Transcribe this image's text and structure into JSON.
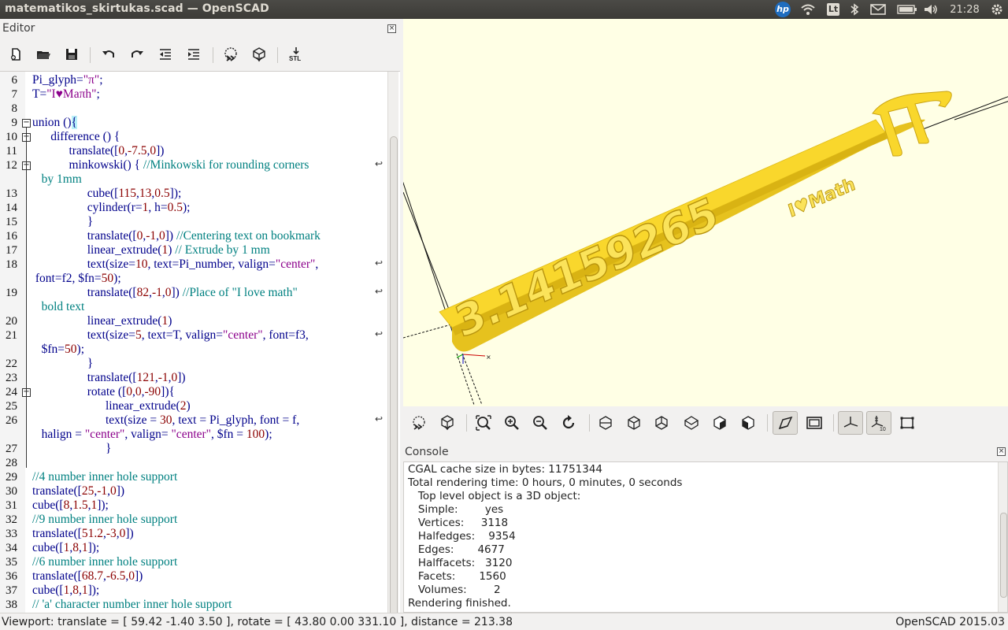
{
  "window": {
    "title": "matematikos_skirtukas.scad — OpenSCAD"
  },
  "tray": {
    "hp_label": "hp",
    "keyboard_layout": "Lt",
    "clock": "21:28",
    "icons": [
      "hp-icon",
      "wifi-icon",
      "keyboard-layout-indicator",
      "bluetooth-icon",
      "mail-icon",
      "battery-icon",
      "volume-icon",
      "settings-gear-icon"
    ]
  },
  "editor": {
    "title": "Editor",
    "toolbar_icons": [
      "new-file-icon",
      "open-file-icon",
      "save-icon",
      "undo-icon",
      "redo-icon",
      "unindent-icon",
      "indent-icon",
      "preview-icon",
      "render-icon",
      "export-stl-icon"
    ],
    "stl_label": "STL",
    "lines": [
      {
        "n": "6",
        "html": "Pi_glyph=<span class=\"str\">\"π\"</span>;"
      },
      {
        "n": "7",
        "html": "T=<span class=\"str\">\"I♥Maπh\"</span>;"
      },
      {
        "n": "8",
        "html": ""
      },
      {
        "n": "9",
        "html": "union ()<span class=\"hl\">{</span>"
      },
      {
        "n": "10",
        "html": "      difference () {"
      },
      {
        "n": "11",
        "html": "            translate([<span class=\"num\">0</span>,<span class=\"num\">-7.5</span>,<span class=\"num\">0</span>])"
      },
      {
        "n": "12",
        "html": "            minkowski() { <span class=\"cm\">//Minkowski for rounding corners</span>"
      },
      {
        "n": "",
        "html": "   <span class=\"cm\">by 1mm</span>"
      },
      {
        "n": "13",
        "html": "                  cube([<span class=\"num\">115</span>,<span class=\"num\">13</span>,<span class=\"num\">0.5</span>]);"
      },
      {
        "n": "14",
        "html": "                  cylinder(r=<span class=\"num\">1</span>, h=<span class=\"num\">0.5</span>);"
      },
      {
        "n": "15",
        "html": "                  }"
      },
      {
        "n": "16",
        "html": "                  translate([<span class=\"num\">0</span>,<span class=\"num\">-1</span>,<span class=\"num\">0</span>]) <span class=\"cm\">//Centering text on bookmark</span>"
      },
      {
        "n": "17",
        "html": "                  linear_extrude(<span class=\"num\">1</span>) <span class=\"cm\">// Extrude by 1 mm</span>"
      },
      {
        "n": "18",
        "html": "                  text(size=<span class=\"num\">10</span>, text=Pi_number, valign=<span class=\"str\">\"center\"</span>,"
      },
      {
        "n": "",
        "html": " font=f2, $fn=<span class=\"num\">50</span>);"
      },
      {
        "n": "19",
        "html": "                  translate([<span class=\"num\">82</span>,<span class=\"num\">-1</span>,<span class=\"num\">0</span>]) <span class=\"cm\">//Place of \"I love math\"</span>"
      },
      {
        "n": "",
        "html": "   <span class=\"cm\">bold text</span>"
      },
      {
        "n": "20",
        "html": "                  linear_extrude(<span class=\"num\">1</span>)"
      },
      {
        "n": "21",
        "html": "                  text(size=<span class=\"num\">5</span>, text=T, valign=<span class=\"str\">\"center\"</span>, font=f3,"
      },
      {
        "n": "",
        "html": "   $fn=<span class=\"num\">50</span>);"
      },
      {
        "n": "22",
        "html": "                  }"
      },
      {
        "n": "23",
        "html": "                  translate([<span class=\"num\">121</span>,<span class=\"num\">-1</span>,<span class=\"num\">0</span>])"
      },
      {
        "n": "24",
        "html": "                  rotate ([<span class=\"num\">0</span>,<span class=\"num\">0</span>,<span class=\"num\">-90</span>]){"
      },
      {
        "n": "25",
        "html": "                        linear_extrude(<span class=\"num\">2</span>)"
      },
      {
        "n": "26",
        "html": "                        text(size = <span class=\"num\">30</span>, text = Pi_glyph, font = f,"
      },
      {
        "n": "",
        "html": "   halign = <span class=\"str\">\"center\"</span>, valign= <span class=\"str\">\"center\"</span>, $fn = <span class=\"num\">100</span>);"
      },
      {
        "n": "27",
        "html": "                        }"
      },
      {
        "n": "28",
        "html": ""
      },
      {
        "n": "29",
        "html": "<span class=\"cm\">//4 number inner hole support</span>"
      },
      {
        "n": "30",
        "html": "translate([<span class=\"num\">25</span>,<span class=\"num\">-1</span>,<span class=\"num\">0</span>])"
      },
      {
        "n": "31",
        "html": "cube([<span class=\"num\">8</span>,<span class=\"num\">1.5</span>,<span class=\"num\">1</span>]);"
      },
      {
        "n": "32",
        "html": "<span class=\"cm\">//9 number inner hole support</span>"
      },
      {
        "n": "33",
        "html": "translate([<span class=\"num\">51.2</span>,<span class=\"num\">-3</span>,<span class=\"num\">0</span>])"
      },
      {
        "n": "34",
        "html": "cube([<span class=\"num\">1</span>,<span class=\"num\">8</span>,<span class=\"num\">1</span>]);"
      },
      {
        "n": "35",
        "html": "<span class=\"cm\">//6 number inner hole support</span>"
      },
      {
        "n": "36",
        "html": "translate([<span class=\"num\">68.7</span>,<span class=\"num\">-6.5</span>,<span class=\"num\">0</span>])"
      },
      {
        "n": "37",
        "html": "cube([<span class=\"num\">1</span>,<span class=\"num\">8</span>,<span class=\"num\">1</span>]);"
      },
      {
        "n": "38",
        "html": "<span class=\"cm\">// 'a' character number inner hole support</span>"
      }
    ]
  },
  "viewport": {
    "background": "#ffffe5",
    "model_color": "#f9d72c",
    "model_text_main": "3.14159265",
    "model_text_small": "I♥Math"
  },
  "view_toolbar": {
    "icons": [
      "preview-icon",
      "render-icon",
      "view-all-icon",
      "zoom-in-icon",
      "zoom-out-icon",
      "reset-view-icon",
      "view-right-icon",
      "view-top-icon",
      "view-bottom-icon",
      "view-left-icon",
      "view-front-icon",
      "view-back-icon",
      "perspective-icon",
      "orthogonal-icon",
      "show-axes-icon",
      "show-scale-markers-icon",
      "show-edges-icon"
    ]
  },
  "console": {
    "title": "Console",
    "lines": [
      "CGAL cache size in bytes: 11751344",
      "Total rendering time: 0 hours, 0 minutes, 0 seconds",
      "   Top level object is a 3D object:",
      "   Simple:        yes",
      "   Vertices:     3118",
      "   Halfedges:    9354",
      "   Edges:       4677",
      "   Halffacets:   3120",
      "   Facets:       1560",
      "   Volumes:        2",
      "Rendering finished."
    ]
  },
  "status": {
    "viewport_info": "Viewport: translate = [ 59.42 -1.40 3.50 ], rotate = [ 43.80 0.00 331.10 ], distance = 213.38",
    "version": "OpenSCAD 2015.03"
  }
}
